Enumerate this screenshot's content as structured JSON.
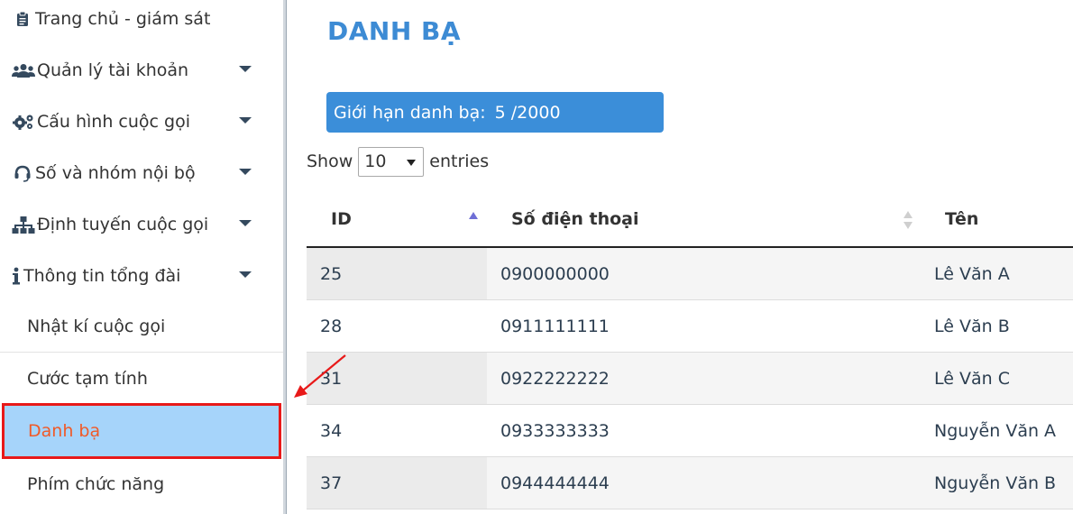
{
  "sidebar": {
    "items": [
      {
        "label": "Trang chủ - giám sát",
        "icon": "clipboard-icon",
        "has_caret": false
      },
      {
        "label": "Quản lý tài khoản",
        "icon": "users-icon",
        "has_caret": true
      },
      {
        "label": "Cấu hình cuộc gọi",
        "icon": "gears-icon",
        "has_caret": true
      },
      {
        "label": "Số và nhóm nội bộ",
        "icon": "headset-icon",
        "has_caret": true
      },
      {
        "label": "Định tuyến cuộc gọi",
        "icon": "sitemap-icon",
        "has_caret": true
      },
      {
        "label": "Thông tin tổng đài",
        "icon": "info-icon",
        "has_caret": true
      }
    ],
    "sub_items": [
      {
        "label": "Nhật kí cuộc gọi",
        "active": false
      },
      {
        "label": "Cước tạm tính",
        "active": false
      },
      {
        "label": "Danh bạ",
        "active": true
      },
      {
        "label": "Phím chức năng",
        "active": false
      }
    ]
  },
  "main": {
    "title": "DANH BẠ",
    "limit": {
      "label": "Giới hạn danh bạ:",
      "value": "5 /2000"
    },
    "show": {
      "prefix": "Show",
      "selected": "10",
      "suffix": "entries"
    }
  },
  "table": {
    "columns": [
      "ID",
      "Số điện thoại",
      "Tên"
    ],
    "rows": [
      {
        "id": "25",
        "phone": "0900000000",
        "name": "Lê Văn A"
      },
      {
        "id": "28",
        "phone": "0911111111",
        "name": "Lê Văn B"
      },
      {
        "id": "31",
        "phone": "0922222222",
        "name": "Lê Văn C"
      },
      {
        "id": "34",
        "phone": "0933333333",
        "name": "Nguyễn Văn A"
      },
      {
        "id": "37",
        "phone": "0944444444",
        "name": "Nguyễn Văn B"
      }
    ]
  },
  "colors": {
    "title": "#3d8bd4",
    "limit_bg": "#3b8ed9",
    "active_bg": "#a6d4fa",
    "active_text": "#f05a28",
    "highlight_border": "#e81919",
    "annotation_arrow": "#e81919"
  }
}
